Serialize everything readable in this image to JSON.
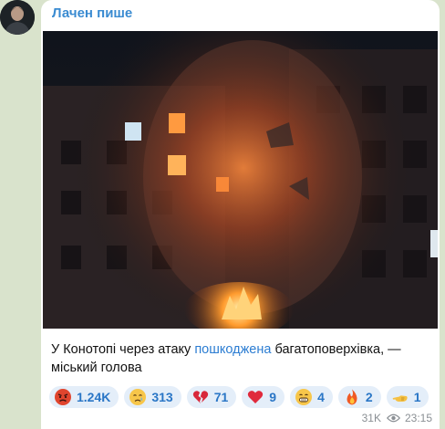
{
  "channel": {
    "name": "Лачен пише"
  },
  "message": {
    "photo_icon": "burning-building-photo",
    "caption_before": "У Конотопі через атаку ",
    "caption_link": "пошкоджена",
    "caption_after": " багатоповерхівка, — міський голова",
    "views": "31K",
    "time": "23:15",
    "view_icon": "eye-icon"
  },
  "reactions": [
    {
      "icon": "angry-face-icon",
      "count": "1.24K"
    },
    {
      "icon": "crying-face-icon",
      "count": "313"
    },
    {
      "icon": "broken-heart-icon",
      "count": "71"
    },
    {
      "icon": "red-heart-icon",
      "count": "9"
    },
    {
      "icon": "grimacing-face-icon",
      "count": "4"
    },
    {
      "icon": "fire-icon",
      "count": "2"
    },
    {
      "icon": "pointing-hand-icon",
      "count": "1"
    }
  ],
  "colors": {
    "background": "#d9e3cc",
    "channel_name": "#3a8bd1",
    "link": "#2c7dd2",
    "reaction_bg": "#e4eef9",
    "reaction_text": "#2a76c6",
    "meta_text": "#8a8f94"
  }
}
